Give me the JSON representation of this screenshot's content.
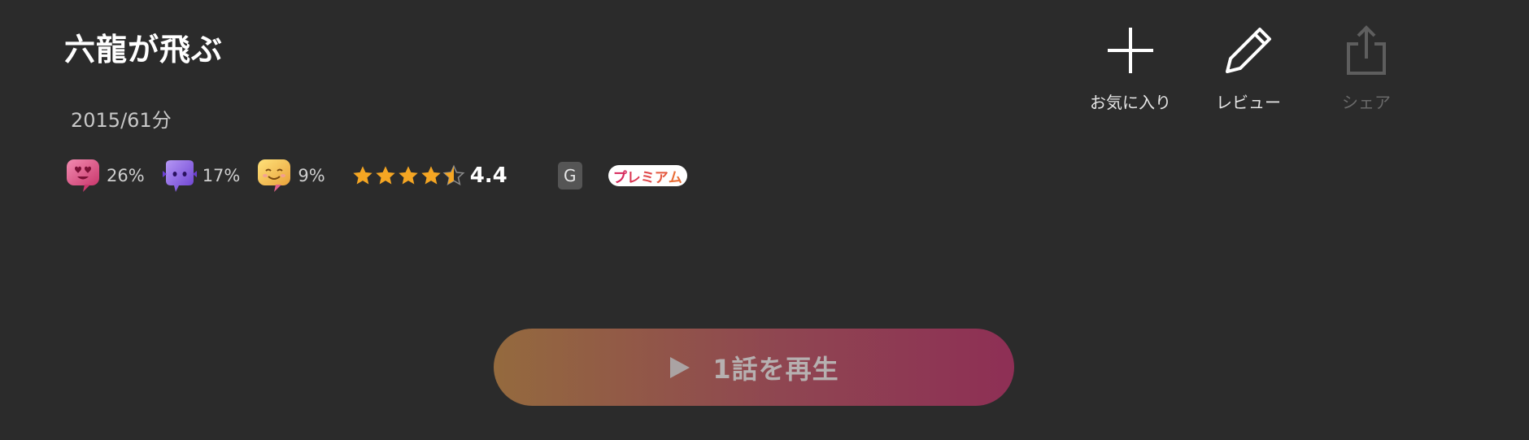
{
  "title": "六龍が飛ぶ",
  "meta": "2015/61分",
  "reactions": [
    {
      "icon": "heart-eyes-reaction-icon",
      "percent": "26%"
    },
    {
      "icon": "purple-face-reaction-icon",
      "percent": "17%"
    },
    {
      "icon": "smiling-face-reaction-icon",
      "percent": "9%"
    }
  ],
  "rating": {
    "value": "4.4",
    "stars_filled": 4.5,
    "stars_total": 5
  },
  "age_rating": "G",
  "premium_badge": "プレミアム",
  "actions": {
    "favorite": "お気に入り",
    "review": "レビュー",
    "share": "シェア"
  },
  "play_button": "1話を再生",
  "colors": {
    "background": "#2b2b2b",
    "play_gradient_start": "#946a3e",
    "play_gradient_end": "#8e2f55",
    "star": "#f5a623",
    "premium_text": "#d6275a"
  }
}
